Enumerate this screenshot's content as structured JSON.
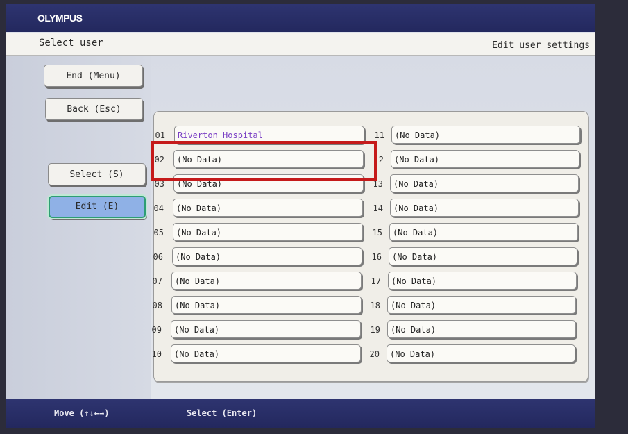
{
  "brand": "OLYMPUS",
  "header": {
    "title": "Select user",
    "right_label": "Edit user settings"
  },
  "sidebar": {
    "end_label": "End (Menu)",
    "back_label": "Back (Esc)",
    "select_label": "Select (S)",
    "edit_label": "Edit (E)",
    "active": "edit"
  },
  "users": {
    "left": [
      {
        "num": "01",
        "name": "Riverton Hospital"
      },
      {
        "num": "02",
        "name": "(No Data)"
      },
      {
        "num": "03",
        "name": "(No Data)"
      },
      {
        "num": "04",
        "name": "(No Data)"
      },
      {
        "num": "05",
        "name": "(No Data)"
      },
      {
        "num": "06",
        "name": "(No Data)"
      },
      {
        "num": "07",
        "name": "(No Data)"
      },
      {
        "num": "08",
        "name": "(No Data)"
      },
      {
        "num": "09",
        "name": "(No Data)"
      },
      {
        "num": "10",
        "name": "(No Data)"
      }
    ],
    "right": [
      {
        "num": "11",
        "name": "(No Data)"
      },
      {
        "num": "12",
        "name": "(No Data)"
      },
      {
        "num": "13",
        "name": "(No Data)"
      },
      {
        "num": "14",
        "name": "(No Data)"
      },
      {
        "num": "15",
        "name": "(No Data)"
      },
      {
        "num": "16",
        "name": "(No Data)"
      },
      {
        "num": "17",
        "name": "(No Data)"
      },
      {
        "num": "18",
        "name": "(No Data)"
      },
      {
        "num": "19",
        "name": "(No Data)"
      },
      {
        "num": "20",
        "name": "(No Data)"
      }
    ],
    "selected_slot": "02"
  },
  "footer": {
    "move_hint": "Move (↑↓←→)",
    "select_hint": "Select (Enter)"
  },
  "colors": {
    "bar": "#23285e",
    "highlight": "#c51a1a",
    "active_button": "#8fb1e6",
    "named_user": "#7a3fc4"
  }
}
